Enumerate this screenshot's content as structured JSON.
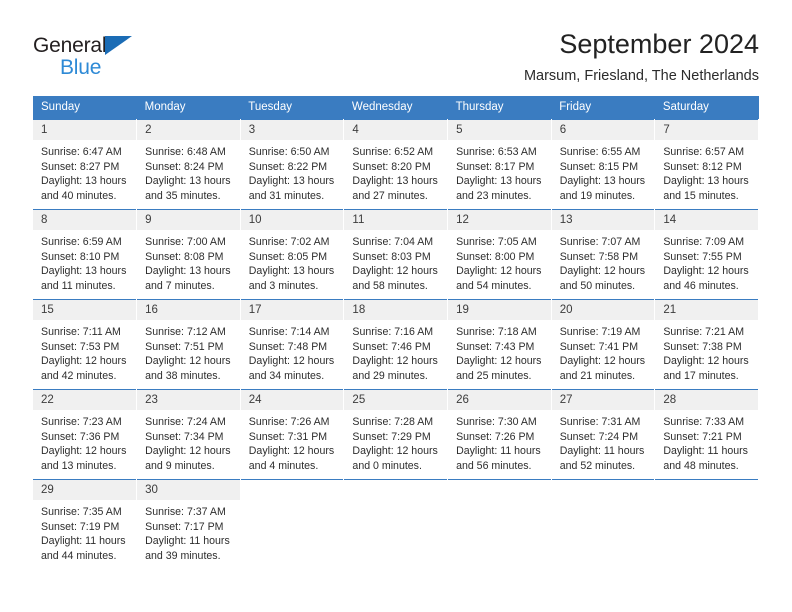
{
  "brand": {
    "name_part1": "General",
    "name_part2": "Blue",
    "triangle_color": "#1b6cb5",
    "blue_color": "#2e8ad6"
  },
  "header": {
    "title": "September 2024",
    "subtitle": "Marsum, Friesland, The Netherlands"
  },
  "theme": {
    "header_bg": "#3a7cc1",
    "daynum_bg": "#f0f0f0",
    "row_border": "#3a7cc1",
    "text": "#2d2d2d"
  },
  "weekdays": [
    "Sunday",
    "Monday",
    "Tuesday",
    "Wednesday",
    "Thursday",
    "Friday",
    "Saturday"
  ],
  "weeks": [
    [
      {
        "day": "1",
        "sunrise": "Sunrise: 6:47 AM",
        "sunset": "Sunset: 8:27 PM",
        "daylight1": "Daylight: 13 hours",
        "daylight2": "and 40 minutes."
      },
      {
        "day": "2",
        "sunrise": "Sunrise: 6:48 AM",
        "sunset": "Sunset: 8:24 PM",
        "daylight1": "Daylight: 13 hours",
        "daylight2": "and 35 minutes."
      },
      {
        "day": "3",
        "sunrise": "Sunrise: 6:50 AM",
        "sunset": "Sunset: 8:22 PM",
        "daylight1": "Daylight: 13 hours",
        "daylight2": "and 31 minutes."
      },
      {
        "day": "4",
        "sunrise": "Sunrise: 6:52 AM",
        "sunset": "Sunset: 8:20 PM",
        "daylight1": "Daylight: 13 hours",
        "daylight2": "and 27 minutes."
      },
      {
        "day": "5",
        "sunrise": "Sunrise: 6:53 AM",
        "sunset": "Sunset: 8:17 PM",
        "daylight1": "Daylight: 13 hours",
        "daylight2": "and 23 minutes."
      },
      {
        "day": "6",
        "sunrise": "Sunrise: 6:55 AM",
        "sunset": "Sunset: 8:15 PM",
        "daylight1": "Daylight: 13 hours",
        "daylight2": "and 19 minutes."
      },
      {
        "day": "7",
        "sunrise": "Sunrise: 6:57 AM",
        "sunset": "Sunset: 8:12 PM",
        "daylight1": "Daylight: 13 hours",
        "daylight2": "and 15 minutes."
      }
    ],
    [
      {
        "day": "8",
        "sunrise": "Sunrise: 6:59 AM",
        "sunset": "Sunset: 8:10 PM",
        "daylight1": "Daylight: 13 hours",
        "daylight2": "and 11 minutes."
      },
      {
        "day": "9",
        "sunrise": "Sunrise: 7:00 AM",
        "sunset": "Sunset: 8:08 PM",
        "daylight1": "Daylight: 13 hours",
        "daylight2": "and 7 minutes."
      },
      {
        "day": "10",
        "sunrise": "Sunrise: 7:02 AM",
        "sunset": "Sunset: 8:05 PM",
        "daylight1": "Daylight: 13 hours",
        "daylight2": "and 3 minutes."
      },
      {
        "day": "11",
        "sunrise": "Sunrise: 7:04 AM",
        "sunset": "Sunset: 8:03 PM",
        "daylight1": "Daylight: 12 hours",
        "daylight2": "and 58 minutes."
      },
      {
        "day": "12",
        "sunrise": "Sunrise: 7:05 AM",
        "sunset": "Sunset: 8:00 PM",
        "daylight1": "Daylight: 12 hours",
        "daylight2": "and 54 minutes."
      },
      {
        "day": "13",
        "sunrise": "Sunrise: 7:07 AM",
        "sunset": "Sunset: 7:58 PM",
        "daylight1": "Daylight: 12 hours",
        "daylight2": "and 50 minutes."
      },
      {
        "day": "14",
        "sunrise": "Sunrise: 7:09 AM",
        "sunset": "Sunset: 7:55 PM",
        "daylight1": "Daylight: 12 hours",
        "daylight2": "and 46 minutes."
      }
    ],
    [
      {
        "day": "15",
        "sunrise": "Sunrise: 7:11 AM",
        "sunset": "Sunset: 7:53 PM",
        "daylight1": "Daylight: 12 hours",
        "daylight2": "and 42 minutes."
      },
      {
        "day": "16",
        "sunrise": "Sunrise: 7:12 AM",
        "sunset": "Sunset: 7:51 PM",
        "daylight1": "Daylight: 12 hours",
        "daylight2": "and 38 minutes."
      },
      {
        "day": "17",
        "sunrise": "Sunrise: 7:14 AM",
        "sunset": "Sunset: 7:48 PM",
        "daylight1": "Daylight: 12 hours",
        "daylight2": "and 34 minutes."
      },
      {
        "day": "18",
        "sunrise": "Sunrise: 7:16 AM",
        "sunset": "Sunset: 7:46 PM",
        "daylight1": "Daylight: 12 hours",
        "daylight2": "and 29 minutes."
      },
      {
        "day": "19",
        "sunrise": "Sunrise: 7:18 AM",
        "sunset": "Sunset: 7:43 PM",
        "daylight1": "Daylight: 12 hours",
        "daylight2": "and 25 minutes."
      },
      {
        "day": "20",
        "sunrise": "Sunrise: 7:19 AM",
        "sunset": "Sunset: 7:41 PM",
        "daylight1": "Daylight: 12 hours",
        "daylight2": "and 21 minutes."
      },
      {
        "day": "21",
        "sunrise": "Sunrise: 7:21 AM",
        "sunset": "Sunset: 7:38 PM",
        "daylight1": "Daylight: 12 hours",
        "daylight2": "and 17 minutes."
      }
    ],
    [
      {
        "day": "22",
        "sunrise": "Sunrise: 7:23 AM",
        "sunset": "Sunset: 7:36 PM",
        "daylight1": "Daylight: 12 hours",
        "daylight2": "and 13 minutes."
      },
      {
        "day": "23",
        "sunrise": "Sunrise: 7:24 AM",
        "sunset": "Sunset: 7:34 PM",
        "daylight1": "Daylight: 12 hours",
        "daylight2": "and 9 minutes."
      },
      {
        "day": "24",
        "sunrise": "Sunrise: 7:26 AM",
        "sunset": "Sunset: 7:31 PM",
        "daylight1": "Daylight: 12 hours",
        "daylight2": "and 4 minutes."
      },
      {
        "day": "25",
        "sunrise": "Sunrise: 7:28 AM",
        "sunset": "Sunset: 7:29 PM",
        "daylight1": "Daylight: 12 hours",
        "daylight2": "and 0 minutes."
      },
      {
        "day": "26",
        "sunrise": "Sunrise: 7:30 AM",
        "sunset": "Sunset: 7:26 PM",
        "daylight1": "Daylight: 11 hours",
        "daylight2": "and 56 minutes."
      },
      {
        "day": "27",
        "sunrise": "Sunrise: 7:31 AM",
        "sunset": "Sunset: 7:24 PM",
        "daylight1": "Daylight: 11 hours",
        "daylight2": "and 52 minutes."
      },
      {
        "day": "28",
        "sunrise": "Sunrise: 7:33 AM",
        "sunset": "Sunset: 7:21 PM",
        "daylight1": "Daylight: 11 hours",
        "daylight2": "and 48 minutes."
      }
    ],
    [
      {
        "day": "29",
        "sunrise": "Sunrise: 7:35 AM",
        "sunset": "Sunset: 7:19 PM",
        "daylight1": "Daylight: 11 hours",
        "daylight2": "and 44 minutes."
      },
      {
        "day": "30",
        "sunrise": "Sunrise: 7:37 AM",
        "sunset": "Sunset: 7:17 PM",
        "daylight1": "Daylight: 11 hours",
        "daylight2": "and 39 minutes."
      },
      {
        "day": "",
        "sunrise": "",
        "sunset": "",
        "daylight1": "",
        "daylight2": ""
      },
      {
        "day": "",
        "sunrise": "",
        "sunset": "",
        "daylight1": "",
        "daylight2": ""
      },
      {
        "day": "",
        "sunrise": "",
        "sunset": "",
        "daylight1": "",
        "daylight2": ""
      },
      {
        "day": "",
        "sunrise": "",
        "sunset": "",
        "daylight1": "",
        "daylight2": ""
      },
      {
        "day": "",
        "sunrise": "",
        "sunset": "",
        "daylight1": "",
        "daylight2": ""
      }
    ]
  ]
}
